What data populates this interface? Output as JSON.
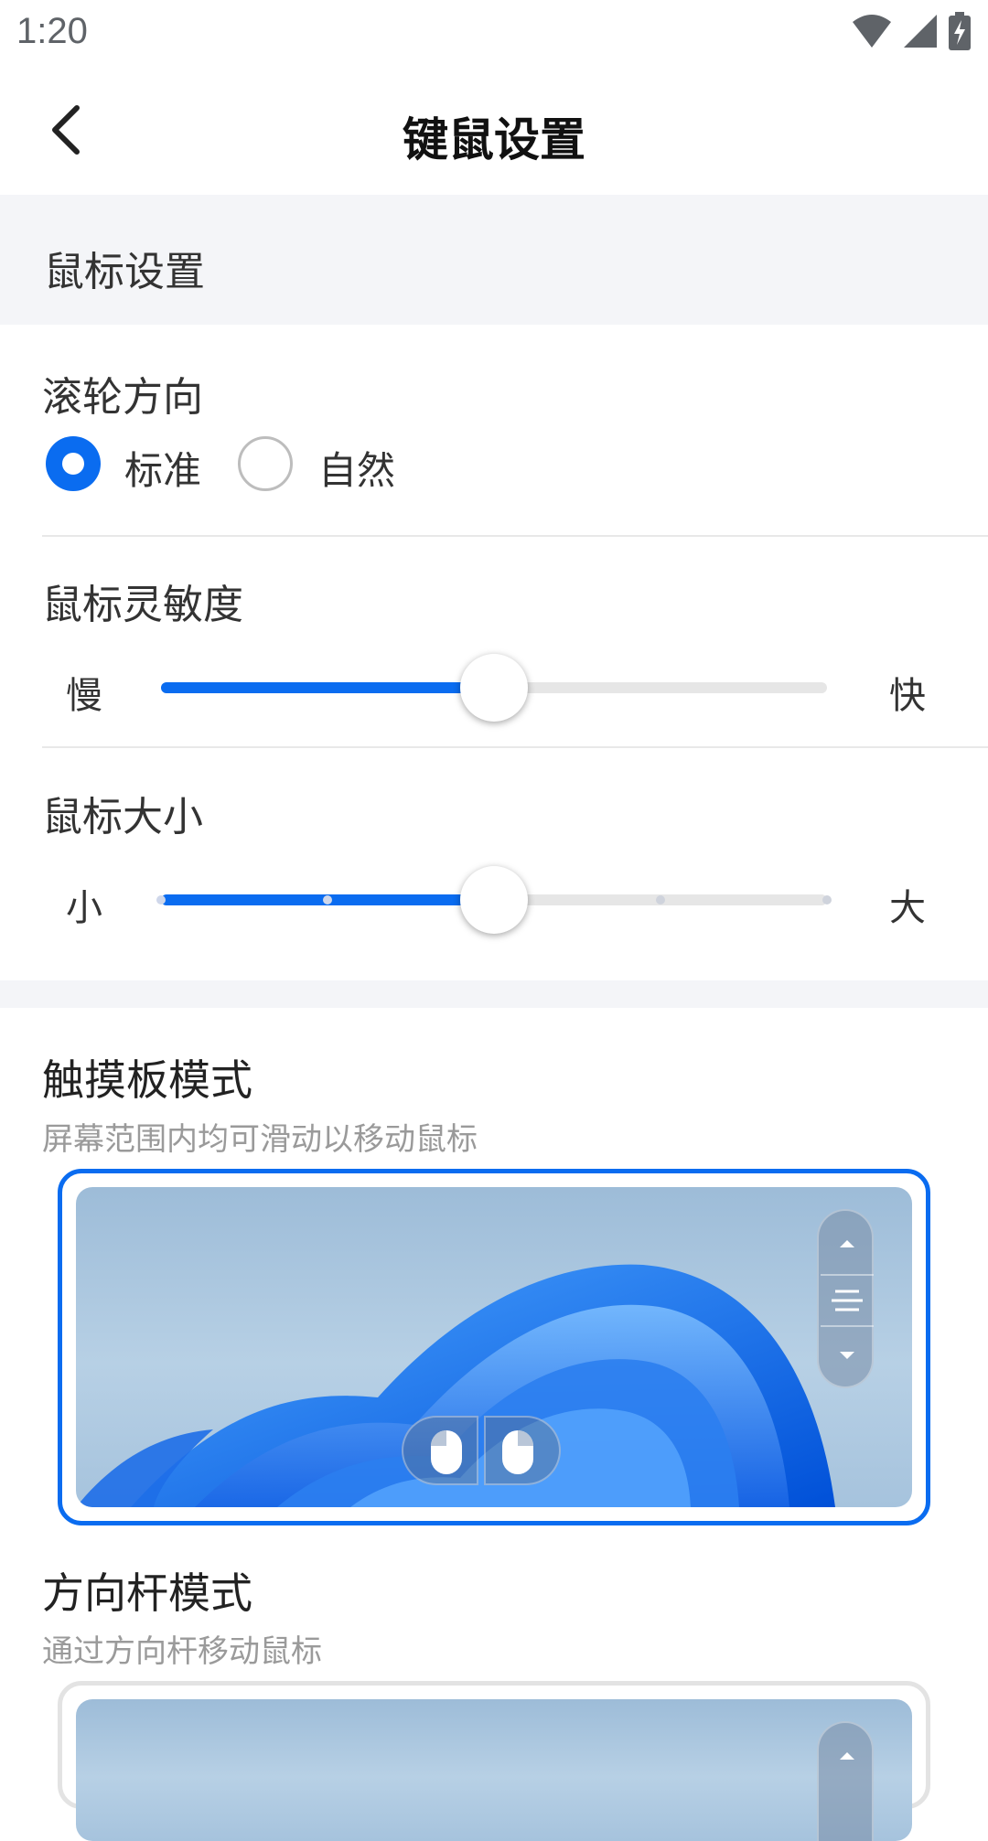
{
  "status_bar": {
    "time": "1:20",
    "icons": [
      "wifi-icon",
      "cell-signal-icon",
      "battery-charging-icon"
    ]
  },
  "header": {
    "back_icon": "chevron-left-icon",
    "title": "键鼠设置"
  },
  "mouse_section": {
    "title": "鼠标设置",
    "scroll_direction": {
      "label": "滚轮方向",
      "options": [
        {
          "label": "标准",
          "selected": true
        },
        {
          "label": "自然",
          "selected": false
        }
      ]
    },
    "sensitivity": {
      "label": "鼠标灵敏度",
      "min_label": "慢",
      "max_label": "快",
      "value_fraction": 0.5
    },
    "size": {
      "label": "鼠标大小",
      "min_label": "小",
      "max_label": "大",
      "steps": 5,
      "value_step": 3
    }
  },
  "modes": [
    {
      "title": "触摸板模式",
      "subtitle": "屏幕范围内均可滑动以移动鼠标",
      "selected": true
    },
    {
      "title": "方向杆模式",
      "subtitle": "通过方向杆移动鼠标",
      "selected": false
    }
  ],
  "colors": {
    "accent": "#0a6cf0",
    "section_bg": "#f4f5f8",
    "track_bg": "#e6e6e6"
  }
}
